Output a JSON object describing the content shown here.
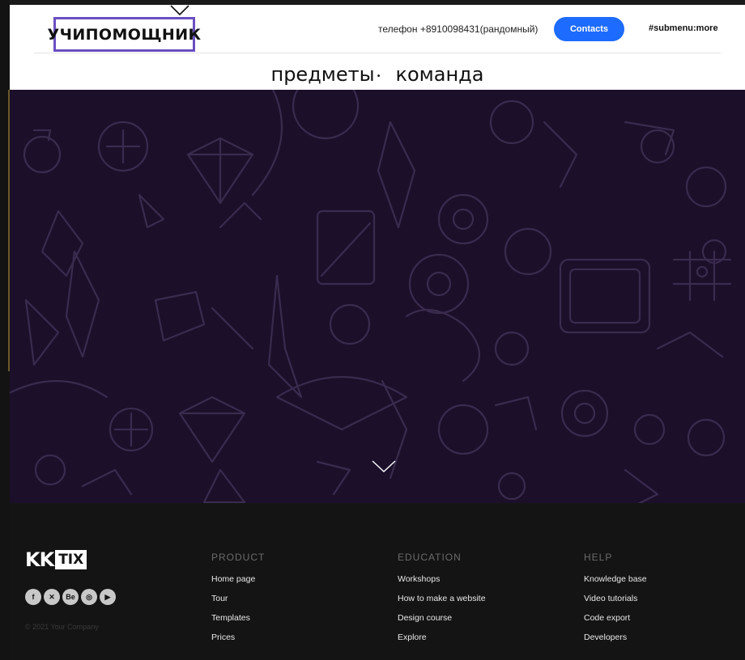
{
  "header": {
    "logo_text": "УЧИПОМОЩНИК",
    "phone": "телефон +8910098431(рандомный)",
    "contacts_label": "Contacts",
    "submenu_label": "#submenu:more",
    "nav": [
      {
        "label": "предметы",
        "has_caret": true
      },
      {
        "label": "команда",
        "has_caret": false
      }
    ]
  },
  "footer": {
    "brand": {
      "part1": "KK",
      "part2": "TIX"
    },
    "socials": [
      {
        "icon": "facebook-icon",
        "glyph": "f"
      },
      {
        "icon": "x-icon",
        "glyph": "✕"
      },
      {
        "icon": "behance-icon",
        "glyph": "Be"
      },
      {
        "icon": "instagram-icon",
        "glyph": "◎"
      },
      {
        "icon": "youtube-icon",
        "glyph": "▶"
      }
    ],
    "copyright": "© 2021 Your Company",
    "columns": {
      "product": {
        "title": "PRODUCT",
        "links": [
          "Home page",
          "Tour",
          "Templates",
          "Prices"
        ]
      },
      "education": {
        "title": "EDUCATION",
        "links": [
          "Workshops",
          "How to make a website",
          "Design course",
          "Explore"
        ]
      },
      "help": {
        "title": "HELP",
        "links": [
          "Knowledge base",
          "Video tutorials",
          "Code export",
          "Developers"
        ]
      }
    }
  },
  "colors": {
    "logo_border": "#6a4fc0",
    "contacts_button": "#1e6bff",
    "hero_bg": "#1b0f2a",
    "footer_bg": "#141414"
  }
}
